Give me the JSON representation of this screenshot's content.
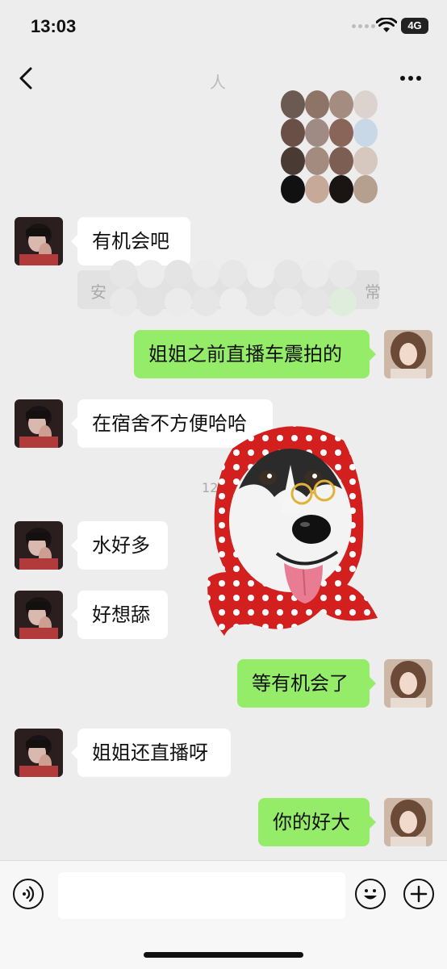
{
  "status_bar": {
    "time": "13:03",
    "network": "4G"
  },
  "nav": {
    "title": "人"
  },
  "ghost": {
    "text_start": "安",
    "text_end": "常",
    "time": "12"
  },
  "messages": [
    {
      "side": "in",
      "text": "有机会吧"
    },
    {
      "side": "out",
      "text": "姐姐之前直播车震拍的"
    },
    {
      "side": "in",
      "text": "在宿舍不方便哈哈"
    },
    {
      "side": "in",
      "text": "水好多"
    },
    {
      "side": "in",
      "text": "好想舔"
    },
    {
      "side": "out",
      "text": "等有机会了"
    },
    {
      "side": "in",
      "text": "姐姐还直播呀"
    },
    {
      "side": "out",
      "text": "你的好大"
    }
  ],
  "input_bar": {
    "placeholder": "",
    "value": ""
  },
  "colors": {
    "background": "#ededed",
    "incoming_bubble": "#ffffff",
    "outgoing_bubble": "#95ec69",
    "bar": "#f7f7f7"
  },
  "icons": {
    "back": "chevron-left-icon",
    "more": "more-dots-icon",
    "voice": "voice-icon",
    "emoji": "emoji-icon",
    "plus": "plus-icon"
  }
}
